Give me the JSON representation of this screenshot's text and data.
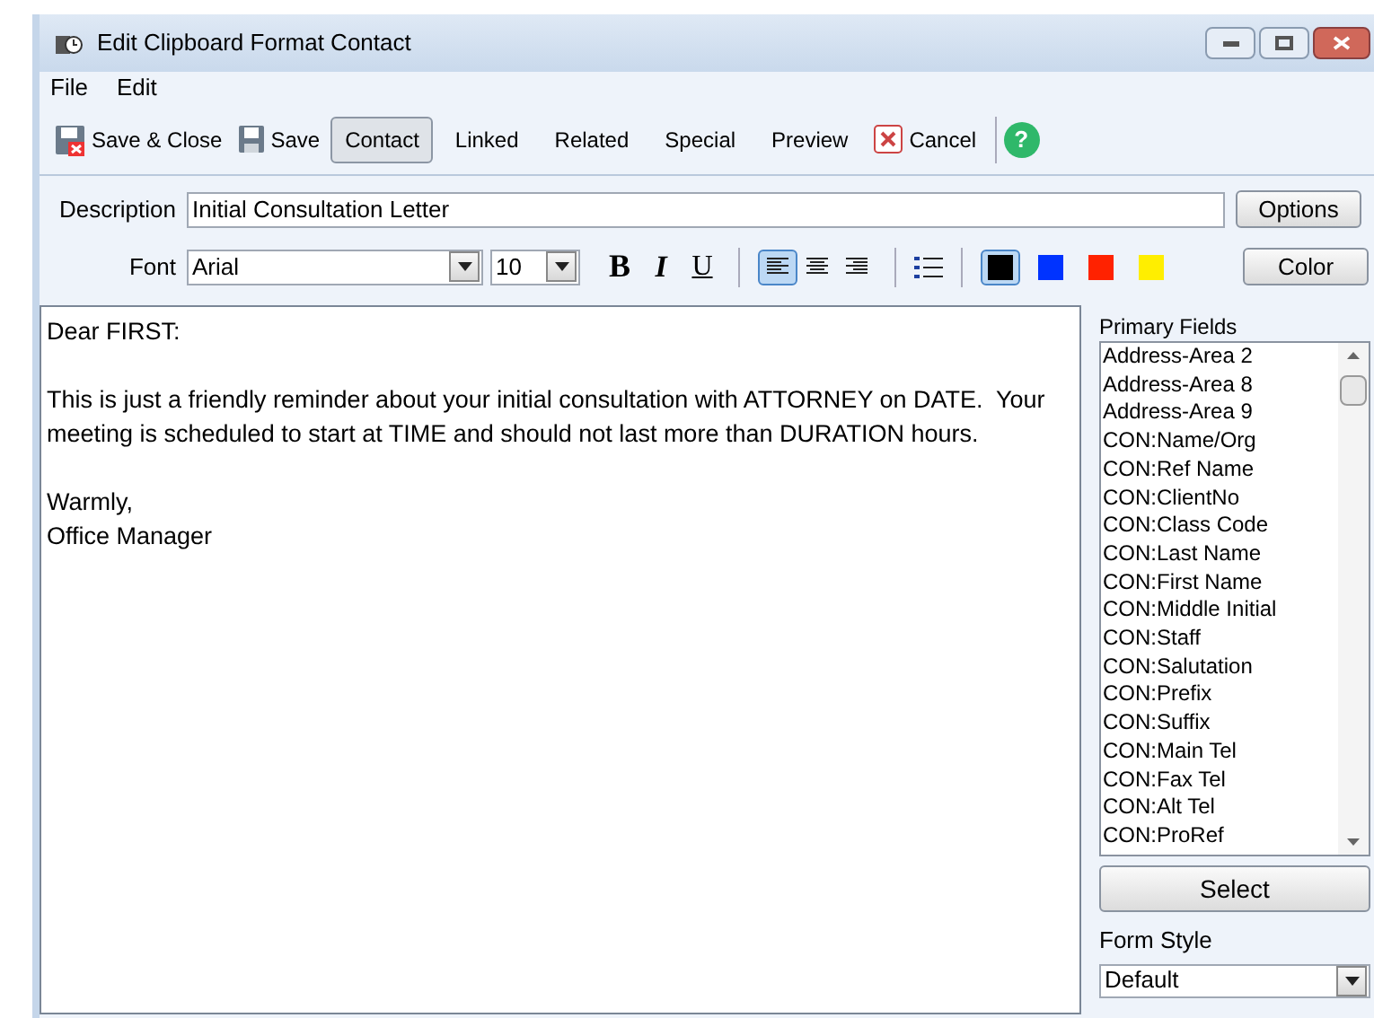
{
  "window": {
    "title": "Edit Clipboard Format Contact"
  },
  "menu": [
    "File",
    "Edit"
  ],
  "toolbar": [
    {
      "label": "Save & Close",
      "kind": "saveclose",
      "selected": false
    },
    {
      "label": "Save",
      "kind": "save",
      "selected": false
    },
    {
      "label": "Contact",
      "kind": "tab",
      "selected": true
    },
    {
      "label": "Linked",
      "kind": "tab",
      "selected": false
    },
    {
      "label": "Related",
      "kind": "tab",
      "selected": false
    },
    {
      "label": "Special",
      "kind": "tab",
      "selected": false
    },
    {
      "label": "Preview",
      "kind": "tab",
      "selected": false
    },
    {
      "label": "Cancel",
      "kind": "cancel",
      "selected": false
    },
    {
      "label": "?",
      "kind": "help",
      "selected": false
    }
  ],
  "description": {
    "label": "Description",
    "value": "Initial Consultation Letter",
    "button": "Options"
  },
  "font": {
    "label": "Font",
    "family": "Arial",
    "size": "10",
    "bold": "B",
    "italic": "I",
    "underline": "U",
    "align": [
      {
        "kind": "left",
        "selected": true
      },
      {
        "kind": "center",
        "selected": false
      },
      {
        "kind": "right",
        "selected": false
      }
    ],
    "colors": [
      {
        "color": "#000000",
        "selected": true
      },
      {
        "color": "#0033ff",
        "selected": false
      },
      {
        "color": "#ff2200",
        "selected": false
      },
      {
        "color": "#ffee00",
        "selected": false
      }
    ],
    "button": "Color"
  },
  "editor": {
    "paragraphs": [
      "Dear FIRST:",
      "This is just a friendly reminder about your initial consultation with ATTORNEY on DATE.  Your meeting is scheduled to start at TIME and should not last more than DURATION hours.",
      "Warmly,\nOffice Manager"
    ]
  },
  "primary_fields": {
    "label": "Primary Fields",
    "items": [
      "Address-Area 2",
      "Address-Area 8",
      "Address-Area 9",
      "CON:Name/Org",
      "CON:Ref Name",
      "CON:ClientNo",
      "CON:Class Code",
      "CON:Last Name",
      "CON:First Name",
      "CON:Middle Initial",
      "CON:Staff",
      "CON:Salutation",
      "CON:Prefix",
      "CON:Suffix",
      "CON:Main Tel",
      "CON:Fax Tel",
      "CON:Alt Tel",
      "CON:ProRef"
    ],
    "button": "Select"
  },
  "form_style": {
    "label": "Form Style",
    "value": "Default"
  }
}
